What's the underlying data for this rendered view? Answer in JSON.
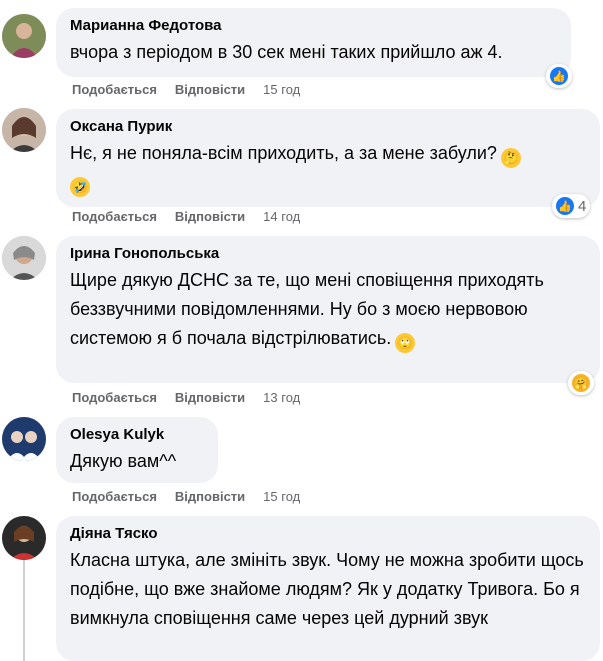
{
  "comments": [
    {
      "author": "Марианна Федотова",
      "text": "вчора з періодом в 30 сек мені таких прийшло аж 4.",
      "like_label": "Подобається",
      "reply_label": "Відповісти",
      "time": "15 год",
      "reaction_icon": "like",
      "reaction_count": ""
    },
    {
      "author": "Оксана Пурик",
      "text": "Нє, я не поняла-всім приходить, а за мене забули?",
      "text_emojis": [
        "thinking-face",
        "rolling-laughing-face"
      ],
      "like_label": "Подобається",
      "reply_label": "Відповісти",
      "time": "14 год",
      "reaction_icon": "like",
      "reaction_count": "4"
    },
    {
      "author": "Ірина Гонопольська",
      "text": "Щире дякую ДСНС за те, що мені сповіщення приходять беззвучними повідомленнями. Ну бо з моєю нервовою системою я б почала відстрілюватись.",
      "text_emojis": [
        "rolling-eyes-face"
      ],
      "like_label": "Подобається",
      "reply_label": "Відповісти",
      "time": "13 год",
      "reaction_icon": "care",
      "reaction_count": ""
    },
    {
      "author": "Olesya Kulyk",
      "text": "Дякую вам^^",
      "like_label": "Подобається",
      "reply_label": "Відповісти",
      "time": "15 год"
    },
    {
      "author": "Діяна Тяско",
      "text": "Класна штука, але змініть звук. Чому не можна зробити щось подібне, що вже знайоме людям? Як у додатку Тривога. Бо я вимкнула сповіщення саме через цей дурний звук"
    }
  ],
  "colors": {
    "bubble": "#f0f2f5",
    "meta_text": "#65676b",
    "like_blue": "#1877f2",
    "care_yellow": "#f7b125"
  }
}
